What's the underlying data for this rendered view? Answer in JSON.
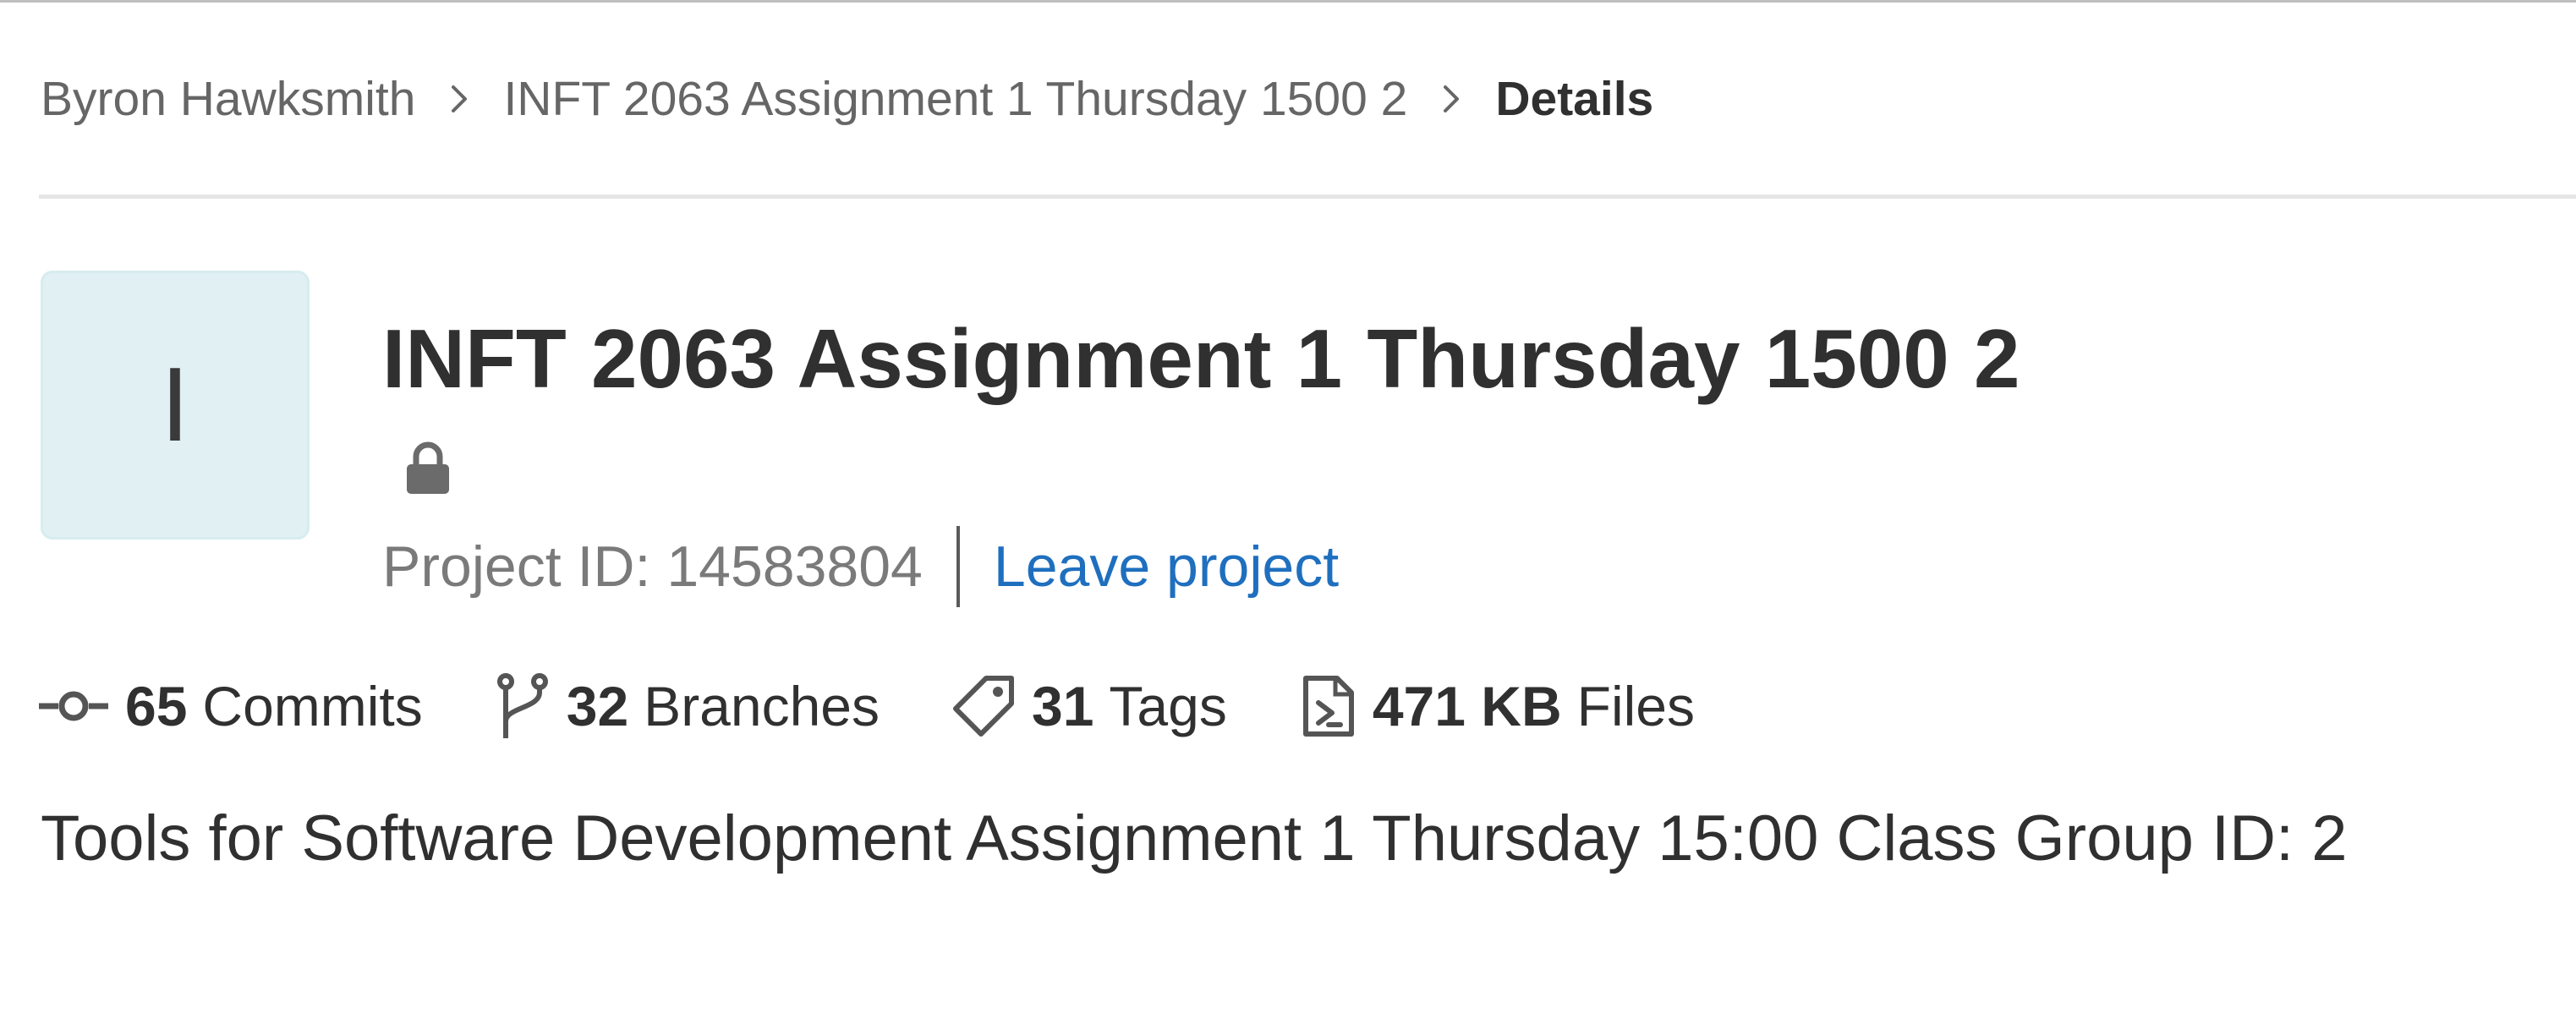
{
  "breadcrumb": {
    "items": [
      {
        "label": "Byron Hawksmith"
      },
      {
        "label": "INFT 2063 Assignment 1 Thursday 1500 2"
      }
    ],
    "current": "Details",
    "separator_icon": "chevron-right-icon"
  },
  "project": {
    "avatar_letter": "I",
    "avatar_color": "#e1f0f2",
    "title": "INFT 2063 Assignment 1 Thursday 1500 2",
    "visibility_icon": "lock-icon",
    "id_text": "Project ID: 14583804",
    "leave_label": "Leave project",
    "link_color": "#1f6fbf",
    "description": "Tools for Software Development Assignment 1 Thursday 15:00 Class Group ID: 2"
  },
  "stats": {
    "commits": {
      "count": "65",
      "label": "Commits",
      "icon": "commit-icon"
    },
    "branches": {
      "count": "32",
      "label": "Branches",
      "icon": "branch-icon"
    },
    "tags": {
      "count": "31",
      "label": "Tags",
      "icon": "tag-icon"
    },
    "files": {
      "count": "471 KB",
      "label": "Files",
      "icon": "file-code-icon"
    }
  }
}
